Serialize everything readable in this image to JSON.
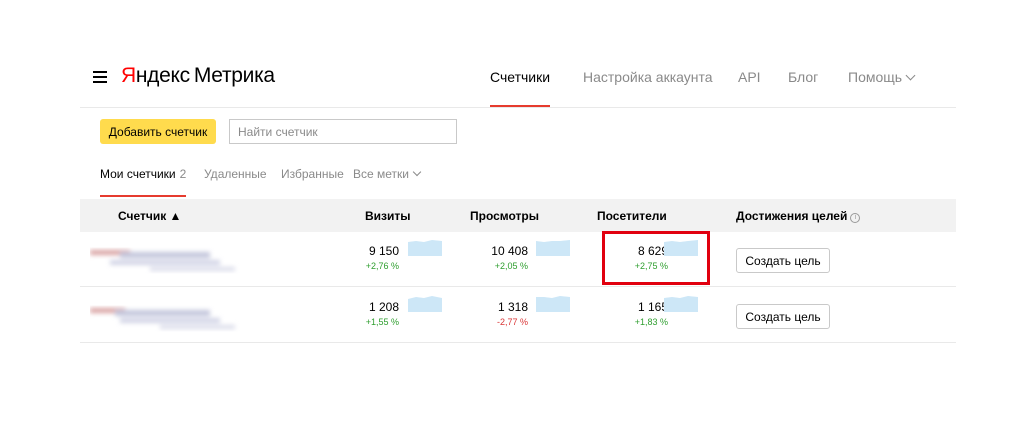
{
  "header": {
    "logo_brand": "Яндекс",
    "logo_product": "Метрика",
    "nav": [
      {
        "label": "Счетчики",
        "active": true
      },
      {
        "label": "Настройка аккаунта",
        "active": false
      },
      {
        "label": "API",
        "active": false
      },
      {
        "label": "Блог",
        "active": false
      },
      {
        "label": "Помощь",
        "active": false
      }
    ]
  },
  "toolbar": {
    "add_label": "Добавить счетчик",
    "search_placeholder": "Найти счетчик"
  },
  "tabs": {
    "mine_label": "Мои счетчики",
    "mine_count": "2",
    "deleted_label": "Удаленные",
    "favorites_label": "Избранные",
    "tags_label": "Все метки"
  },
  "table": {
    "columns": {
      "counter": "Счетчик ▲",
      "visits": "Визиты",
      "views": "Просмотры",
      "visitors": "Посетители",
      "goals": "Достижения целей"
    },
    "rows": [
      {
        "visits": {
          "value": "9 150",
          "change": "+2,76 %"
        },
        "views": {
          "value": "10 408",
          "change": "+2,05 %"
        },
        "visitors": {
          "value": "8 629",
          "change": "+2,75 %"
        },
        "goal_label": "Создать цель"
      },
      {
        "visits": {
          "value": "1 208",
          "change": "+1,55 %"
        },
        "views": {
          "value": "1 318",
          "change": "-2,77 %"
        },
        "visitors": {
          "value": "1 165",
          "change": "+1,83 %"
        },
        "goal_label": "Создать цель"
      }
    ]
  },
  "colors": {
    "accent_yellow": "#ffdb4d",
    "accent_red": "#e63b2e",
    "positive": "#2e9e2e",
    "negative": "#d93535",
    "highlight": "#e1000f",
    "sparkline": "#cde7f7"
  }
}
